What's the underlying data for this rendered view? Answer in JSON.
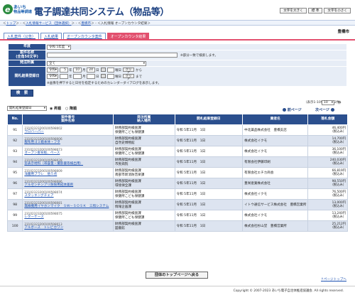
{
  "header": {
    "logo_top": "あいち",
    "logo_bottom": "物品等調達",
    "title": "電子調達共同システム（物品等）",
    "size_buttons": [
      "文字を大きく",
      "標 準",
      "文字を小さく"
    ],
    "breadcrumb": [
      "トップ",
      "入札情報サービス（団体選択）",
      "豊橋市",
      "入札情報 オープンカウンタ結果"
    ],
    "org_name": "豊橋市"
  },
  "tabs": [
    "入札案件（公告）",
    "入札結果",
    "オープンカウンタ案件",
    "オープンカウンタ結果"
  ],
  "search": {
    "labels": {
      "year": "年度",
      "case_name": "案件名称\n(全角50文字)",
      "dept": "発注所属",
      "date": "開札結果登録日"
    },
    "year_value": "令和 5年度",
    "case_name_value": "",
    "case_name_hint": "※部分一致で検索します。",
    "dept_value": "全て",
    "date_from": {
      "era": "令和",
      "year": "5",
      "month": "10",
      "day": "24"
    },
    "date_to": {
      "era": "令和",
      "year": "",
      "month": "",
      "day": ""
    },
    "weekday_suffix": "曜日",
    "clear_label": "クリア",
    "from_label": "から",
    "to_label": "まで",
    "date_note": "※画像を押下すると日付を指定するためのカレンダーダイアログを表示します。",
    "year_unit": "年",
    "month_unit": "月",
    "day_unit": "日",
    "button": "検　索"
  },
  "list": {
    "count_text": "（表示1-10件 / 全312件）",
    "sort_value": "開札結果登録日",
    "radio_asc": "昇順",
    "radio_desc": "降順",
    "per_page": "10",
    "per_page_unit": "件",
    "prev": "前ページ",
    "next": "次ページ",
    "headers": [
      "No.",
      "案件番号\n案件名称",
      "発注所属\n納入場所",
      "開札結果登録日",
      "業者名",
      "落札金額"
    ]
  },
  "rows": [
    {
      "no": "91",
      "case_no": "23102323200100598002",
      "case_name": "ウロバーパー",
      "dept": "財務部契約検査課",
      "place": "保健所こども保健課",
      "date": "令和 5年11月　1日",
      "vendor": "中北薬品株式会社　豊橋支店",
      "amount": "46,400円",
      "tax": "（税込み）"
    },
    {
      "no": "92",
      "case_no": "23102323200100598006",
      "case_name": "服布用ゴミ箱本体・フタ",
      "dept": "財務部契約検査課",
      "place": "自然史博物館",
      "date": "令和 5年11月　1日",
      "vendor": "株式会社イクモ",
      "amount": "14,700円",
      "tax": "（税込み）"
    },
    {
      "no": "93",
      "case_no": "23102323200100598073",
      "case_name": "オープン後背板、ペース",
      "dept": "財務部契約検査課",
      "place": "保健所こども保健課",
      "date": "令和 5年11月　1日",
      "vendor": "株式会社イクモ",
      "amount": "36,100円",
      "tax": "（税込み）"
    },
    {
      "no": "94",
      "case_no": "23102323200100598028",
      "case_name": "窓表示材料（帯容量・撮影書等検出用）",
      "dept": "財務部契約検査課",
      "place": "市民病院",
      "date": "令和 5年11月　1日",
      "vendor": "有限会社伊藤印刷",
      "amount": "240,030円",
      "tax": "（税込み）"
    },
    {
      "no": "95",
      "case_no": "23102323200100598009",
      "case_name": "浅層用プラレ　他５点",
      "dept": "財務部契約検査課",
      "place": "南部市新消防音楽課",
      "date": "令和 5年11月　1日",
      "vendor": "有限会社エチカ商会",
      "amount": "66,819円",
      "tax": "（税込み）"
    },
    {
      "no": "96",
      "case_no": "23102323200100598086",
      "case_name": "アルゼンチンアリ防除用成体薬剤",
      "dept": "財務部契約検査課",
      "place": "環境保全課",
      "date": "令和 5年11月　1日",
      "vendor": "豊栄産業株式会社",
      "amount": "98,550円",
      "tax": "（税込み）"
    },
    {
      "no": "97",
      "case_no": "23102323200100598074",
      "case_name": "スタッキングチェア",
      "dept": "財務部契約検査課",
      "place": "保健所こども保健課",
      "date": "令和 5年11月　1日",
      "vendor": "株式会社イクモ",
      "amount": "76,500円",
      "tax": "（税込み）"
    },
    {
      "no": "98",
      "case_no": "23102323200100598081",
      "case_name": "無線機用イヤホンマイク　ＳＷ－ＳＯＳＫ　三和システム",
      "dept": "財務部契約検査課",
      "place": "情報企画課",
      "date": "令和 5年11月　1日",
      "vendor": "イトウ通信サービス株式会社　豊橋営業所",
      "amount": "13,000円",
      "tax": "（税込み）"
    },
    {
      "no": "99",
      "case_no": "23102323200100598075",
      "case_name": "レターケース",
      "dept": "財務部契約検査課",
      "place": "保健所こども保健課",
      "date": "令和 5年11月　1日",
      "vendor": "株式会社イクモ",
      "amount": "13,240円",
      "tax": "（税込み）"
    },
    {
      "no": "100",
      "case_no": "23102323200100598013",
      "case_name": "アルボース　トレピカワン",
      "dept": "財務部契約検査課",
      "place": "図書館",
      "date": "令和 5年11月　1日",
      "vendor": "株式会社杉山堂　豊橋営業所",
      "amount": "25,212円",
      "tax": "（税込み）"
    }
  ],
  "back_button": "団体のトップページへ戻る",
  "page_top": "ページトップへ",
  "copyright": "Copyright © 2007-2023 あいち電子自治体推進協議会. All rights reserved.",
  "colors": {
    "header_blue": "#2b4f8e",
    "tab_active": "#e2506e",
    "row_alt": "#dde4f0"
  }
}
